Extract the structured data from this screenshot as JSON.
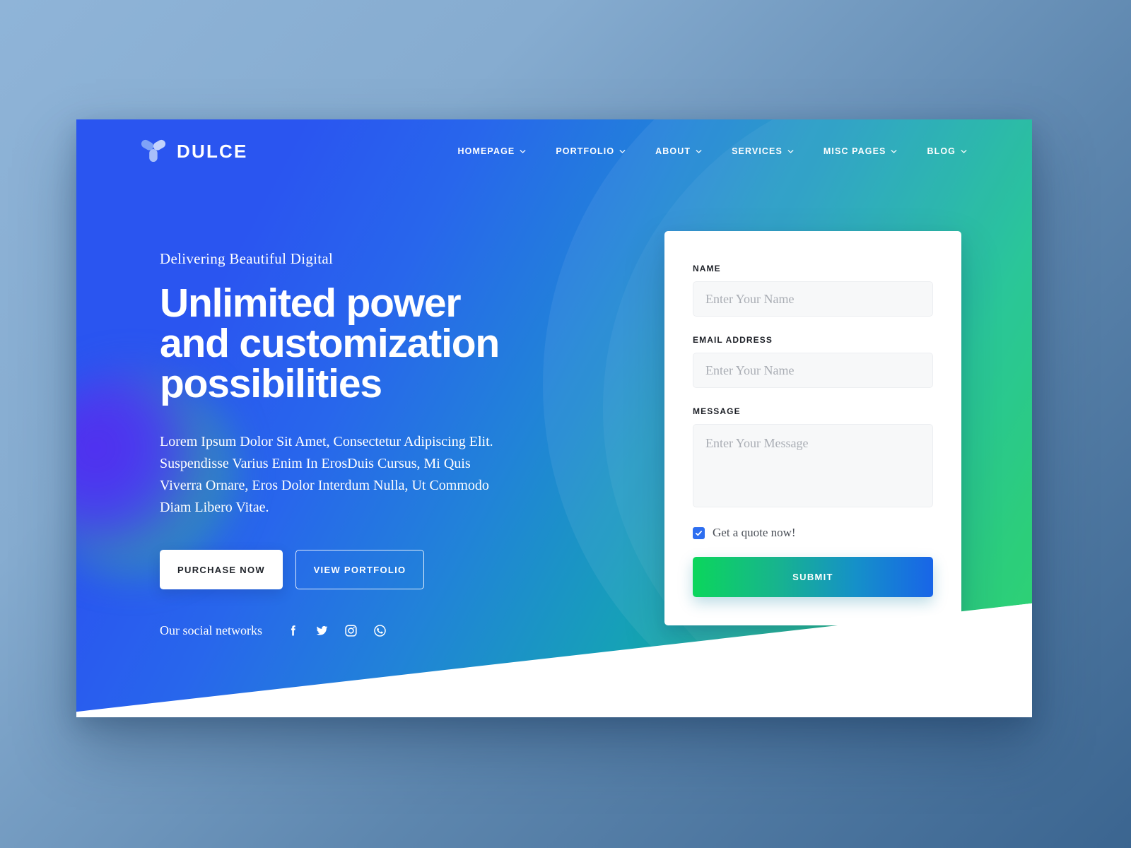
{
  "brand": {
    "name": "DULCE",
    "logo_icon": "trefoil-logo-icon"
  },
  "nav": {
    "items": [
      {
        "label": "HOMEPAGE",
        "caret": "chevron-down-icon"
      },
      {
        "label": "PORTFOLIO",
        "caret": "chevron-down-icon"
      },
      {
        "label": "ABOUT",
        "caret": "chevron-down-icon"
      },
      {
        "label": "SERVICES",
        "caret": "chevron-down-icon"
      },
      {
        "label": "MISC PAGES",
        "caret": "chevron-down-icon"
      },
      {
        "label": "BLOG",
        "caret": "chevron-down-icon"
      }
    ]
  },
  "hero": {
    "eyebrow": "Delivering Beautiful Digital",
    "title_line_1": "Unlimited power",
    "title_line_2": "and customization",
    "title_line_3": "possibilities",
    "paragraph": "Lorem Ipsum Dolor Sit Amet, Consectetur Adipiscing Elit. Suspendisse Varius Enim In ErosDuis Cursus, Mi Quis Viverra Ornare, Eros Dolor Interdum Nulla, Ut Commodo Diam Libero Vitae.",
    "primary_button": "PURCHASE NOW",
    "secondary_button": "VIEW PORTFOLIO",
    "social_label": "Our social networks",
    "social_icons": [
      "facebook-icon",
      "twitter-icon",
      "instagram-icon",
      "whatsapp-icon"
    ]
  },
  "form": {
    "name_label": "NAME",
    "name_placeholder": "Enter Your Name",
    "email_label": "EMAIL ADDRESS",
    "email_placeholder": "Enter Your Name",
    "message_label": "MESSAGE",
    "message_placeholder": "Enter Your Message",
    "checkbox_label": "Get a quote now!",
    "checkbox_checked": true,
    "submit_label": "SUBMIT"
  },
  "colors": {
    "hero_blue": "#2a55f0",
    "hero_teal": "#16a0b8",
    "hero_green": "#15cf5c",
    "accent_blue": "#2d6ef0",
    "page_backdrop_light": "#8fb4d8",
    "page_backdrop_dark": "#3b6590"
  }
}
